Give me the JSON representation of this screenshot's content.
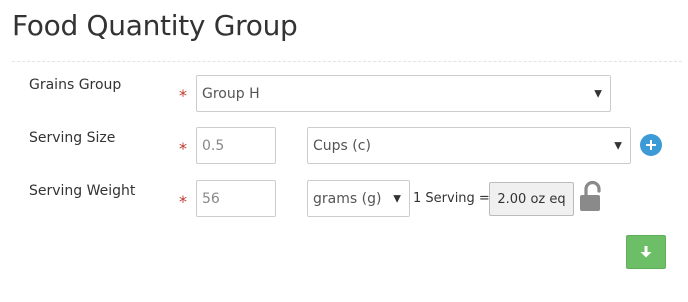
{
  "page": {
    "title": "Food Quantity Group"
  },
  "form": {
    "grains_group": {
      "label": "Grains Group",
      "required_marker": "*",
      "selected": "Group H"
    },
    "serving_size": {
      "label": "Serving Size",
      "required_marker": "*",
      "value": "0.5",
      "unit_selected": "Cups (c)"
    },
    "serving_weight": {
      "label": "Serving Weight",
      "required_marker": "*",
      "value": "56",
      "unit_selected": "grams (g)",
      "equivalence_label": "1 Serving =",
      "equivalence_value": "2.00  oz eq"
    }
  },
  "icons": {
    "add": "plus-circle-icon",
    "lock": "unlocked-padlock-icon",
    "submit": "arrow-down-icon"
  },
  "colors": {
    "required": "#c0392b",
    "add_button": "#3c9ad6",
    "submit_button": "#6dbf67",
    "lock": "#8a8a8a"
  }
}
